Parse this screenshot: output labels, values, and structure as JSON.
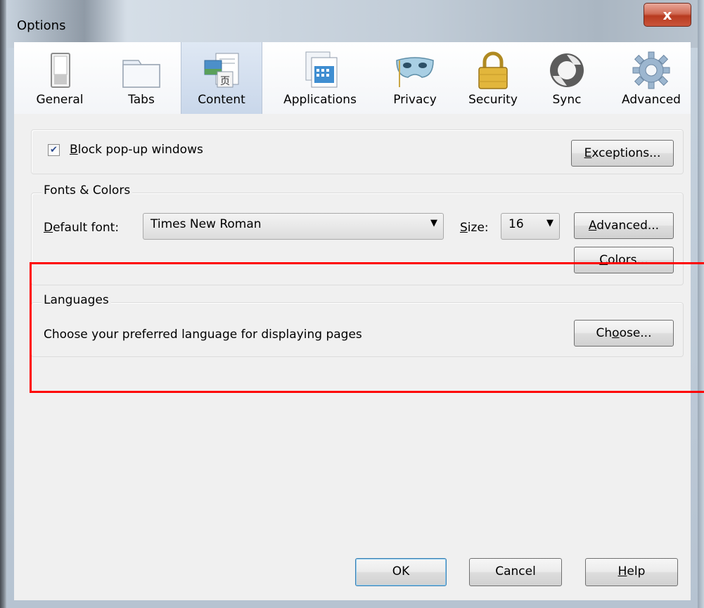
{
  "window": {
    "title": "Options",
    "close_glyph": "x"
  },
  "toolbar": {
    "items": [
      {
        "label": "General",
        "icon": "general-switch-icon"
      },
      {
        "label": "Tabs",
        "icon": "tabs-folder-icon"
      },
      {
        "label": "Content",
        "icon": "content-page-icon",
        "selected": true
      },
      {
        "label": "Applications",
        "icon": "applications-window-icon"
      },
      {
        "label": "Privacy",
        "icon": "privacy-mask-icon"
      },
      {
        "label": "Security",
        "icon": "security-padlock-icon"
      },
      {
        "label": "Sync",
        "icon": "sync-arrows-icon"
      },
      {
        "label": "Advanced",
        "icon": "advanced-gear-icon"
      }
    ]
  },
  "popups": {
    "checkbox_checked": true,
    "label_first": "B",
    "label_rest": "lock pop-up windows",
    "exceptions_first": "E",
    "exceptions_rest": "xceptions..."
  },
  "fonts": {
    "group_label": "Fonts & Colors",
    "default_font_first": "D",
    "default_font_rest": "efault font:",
    "default_font_value": "Times New Roman",
    "size_first": "S",
    "size_rest": "ize:",
    "size_value": "16",
    "advanced_first": "A",
    "advanced_rest": "dvanced...",
    "colors_first": "C",
    "colors_rest": "olors..."
  },
  "languages": {
    "group_label": "Languages",
    "description": "Choose your preferred language for displaying pages",
    "choose_pre": "Ch",
    "choose_u": "o",
    "choose_post": "ose..."
  },
  "footer": {
    "ok": "OK",
    "cancel": "Cancel",
    "help_first": "H",
    "help_rest": "elp"
  },
  "colors": {
    "highlight": "#ff0000",
    "selected_tab": "#c9d7ea"
  }
}
